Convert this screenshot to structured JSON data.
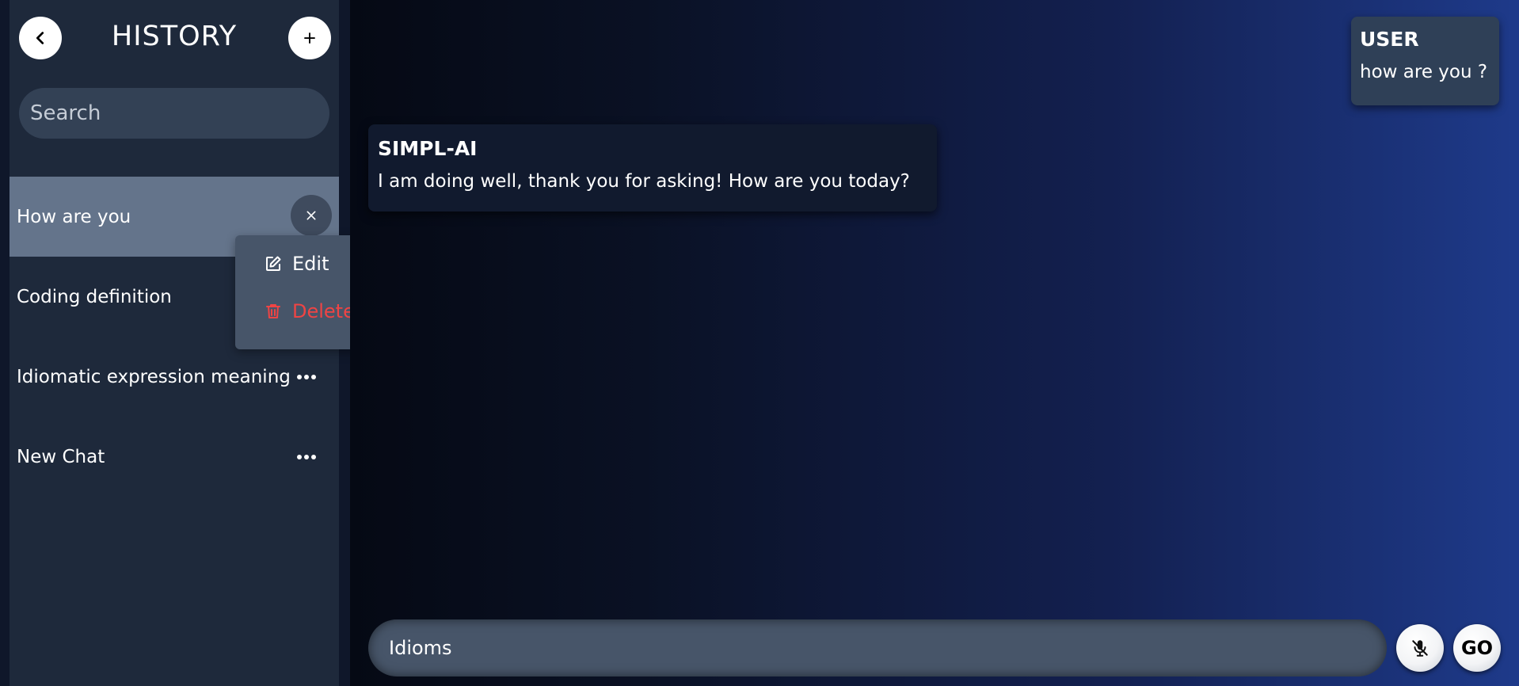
{
  "sidebar": {
    "title": "HISTORY",
    "search_placeholder": "Search",
    "items": [
      {
        "label": "How are you"
      },
      {
        "label": "Coding definition"
      },
      {
        "label": "Idiomatic expression meaning"
      },
      {
        "label": "New Chat"
      }
    ],
    "context_menu": {
      "edit_label": "Edit",
      "delete_label": "Delete"
    }
  },
  "chat": {
    "user_message": {
      "sender": "USER",
      "text": "how are you ?"
    },
    "ai_message": {
      "sender": "SIMPL-AI",
      "text": "I am doing well, thank you for asking!  How are you today?"
    }
  },
  "composer": {
    "value": "Idioms",
    "go_label": "GO"
  },
  "icons": {
    "back": "chevron-left-icon",
    "new_chat": "plus-icon",
    "close": "close-icon",
    "more": "more-horizontal-icon",
    "edit": "edit-icon",
    "delete": "trash-icon",
    "mic": "mic-off-icon"
  },
  "colors": {
    "sidebar_bg": "#1e293b",
    "active_item": "#64748b",
    "menu_bg": "#475569",
    "delete_red": "#ef4444",
    "accent_blue": "#1e3a8a"
  }
}
